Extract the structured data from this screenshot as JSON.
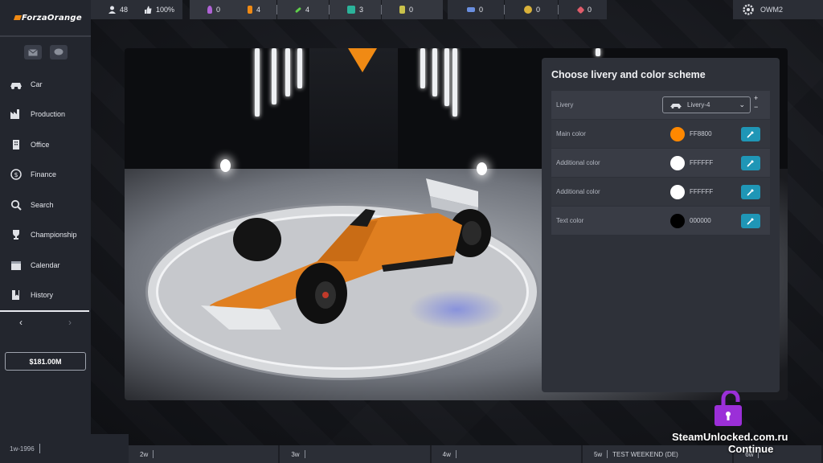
{
  "colors": {
    "accent": "#F08A14",
    "picker": "#1F96B6",
    "sidebar": "#23262E",
    "panel": "#2E3139"
  },
  "topbar": {
    "stats": [
      {
        "icon": "fans-icon",
        "value": "48"
      },
      {
        "icon": "thumbs-up-icon",
        "value": "100%"
      },
      {
        "icon": "potion-icon",
        "value": "0"
      },
      {
        "icon": "engineer-icon",
        "value": "4"
      },
      {
        "icon": "wrench-icon",
        "value": "4"
      },
      {
        "icon": "toolbox-icon",
        "value": "3"
      },
      {
        "icon": "flask-icon",
        "value": "0"
      },
      {
        "icon": "gamepad-icon",
        "value": "0"
      },
      {
        "icon": "coin-icon",
        "value": "0"
      },
      {
        "icon": "gem-icon",
        "value": "0"
      }
    ],
    "user": "OWM2"
  },
  "sidebar": {
    "logo": "ForzaOrange",
    "items": [
      {
        "label": "Car",
        "icon": "car-icon"
      },
      {
        "label": "Production",
        "icon": "factory-icon"
      },
      {
        "label": "Office",
        "icon": "building-icon"
      },
      {
        "label": "Finance",
        "icon": "dollar-icon"
      },
      {
        "label": "Search",
        "icon": "search-icon"
      },
      {
        "label": "Championship",
        "icon": "trophy-icon"
      },
      {
        "label": "Calendar",
        "icon": "calendar-icon"
      },
      {
        "label": "History",
        "icon": "book-icon"
      }
    ],
    "money": "$181.00M",
    "date": "1w-1996"
  },
  "timeline": [
    {
      "week": "2w",
      "label": ""
    },
    {
      "week": "3w",
      "label": ""
    },
    {
      "week": "4w",
      "label": ""
    },
    {
      "week": "5w",
      "label": "TEST WEEKEND (DE)"
    },
    {
      "week": "6w",
      "label": ""
    }
  ],
  "panel": {
    "title": "Choose livery and color scheme",
    "livery": {
      "label": "Livery",
      "value": "Livery-4",
      "plus": "+",
      "minus": "−"
    },
    "colors": [
      {
        "label": "Main color",
        "hex": "FF8800",
        "swatch": "#FF8800"
      },
      {
        "label": "Additional color",
        "hex": "FFFFFF",
        "swatch": "#FFFFFF"
      },
      {
        "label": "Additional color",
        "hex": "FFFFFF",
        "swatch": "#FFFFFF"
      },
      {
        "label": "Text color",
        "hex": "000000",
        "swatch": "#000000"
      }
    ]
  },
  "watermark": "SteamUnlocked.com.ru",
  "continue_label": "Continue"
}
